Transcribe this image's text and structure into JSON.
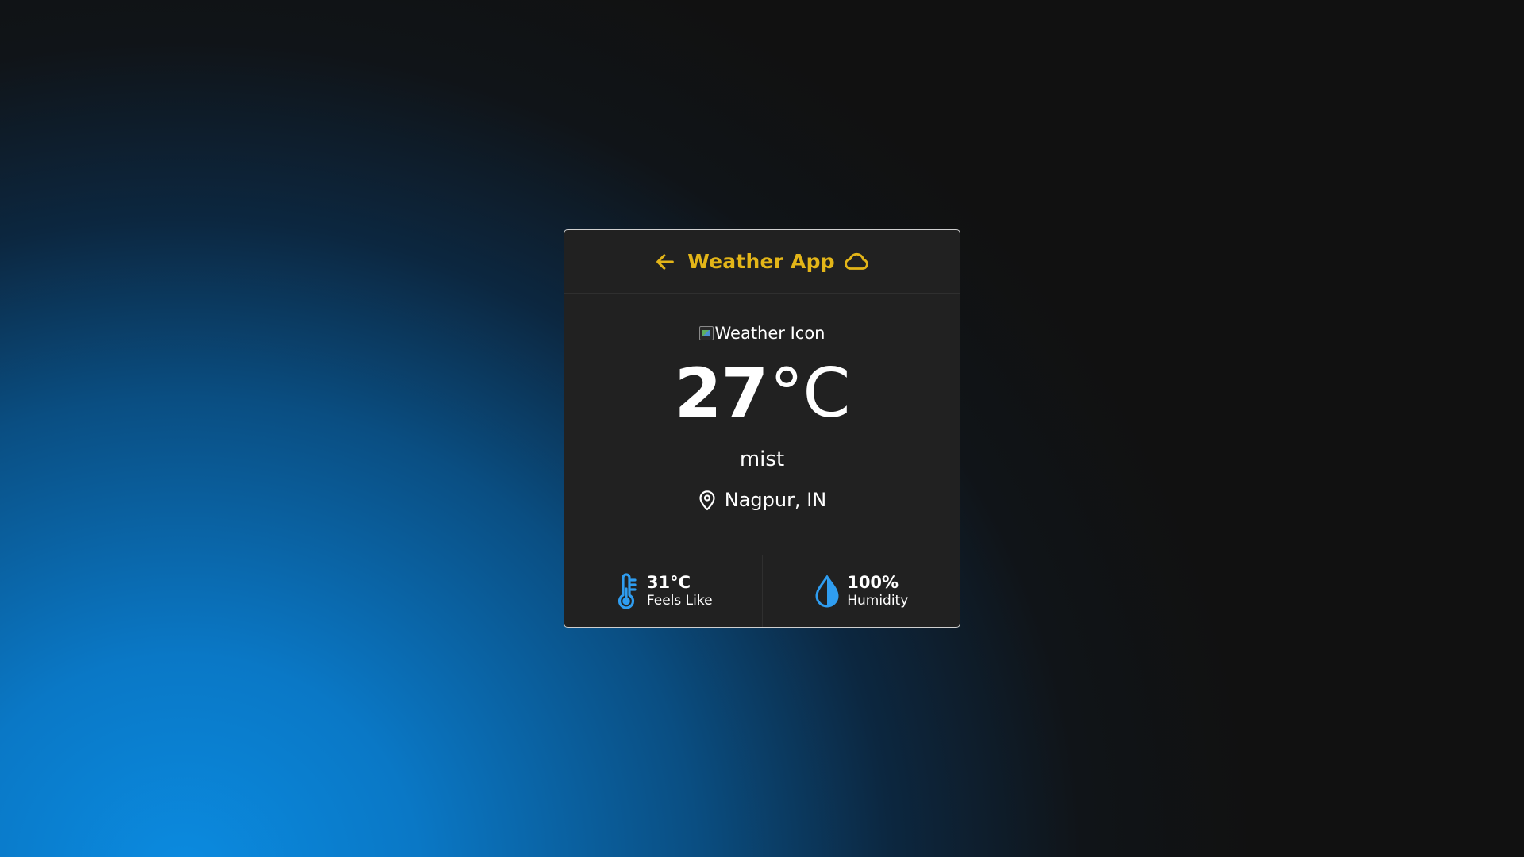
{
  "header": {
    "back_icon": "arrow-left-icon",
    "title": "Weather App",
    "title_icon": "cloud-icon",
    "accent_color": "#e3b518"
  },
  "weather": {
    "icon_alt": "Weather Icon",
    "temperature": "27",
    "temperature_unit": "°C",
    "description": "mist",
    "location_icon": "map-pin-icon",
    "location": "Nagpur, IN"
  },
  "stats": {
    "feels_like": {
      "icon": "thermometer-icon",
      "value": "31°C",
      "label": "Feels Like"
    },
    "humidity": {
      "icon": "water-drop-icon",
      "value": "100%",
      "label": "Humidity"
    },
    "icon_color": "#2f9df0"
  },
  "colors": {
    "card_background": "#212121",
    "page_gradient_start": "#0b8be0",
    "page_gradient_end": "#111111"
  }
}
